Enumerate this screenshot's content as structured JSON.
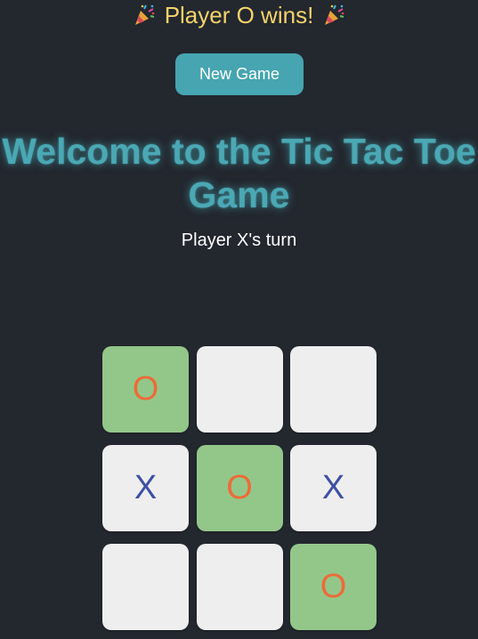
{
  "banner": {
    "message": "Player O wins!",
    "icon_left": "party-popper-icon",
    "icon_right": "party-popper-icon"
  },
  "controls": {
    "new_game_label": "New Game"
  },
  "header": {
    "title": "Welcome to the Tic Tac Toe Game"
  },
  "status": {
    "text": "Player X's turn"
  },
  "board": {
    "cells": [
      {
        "value": "O",
        "winning": true
      },
      {
        "value": "",
        "winning": false
      },
      {
        "value": "",
        "winning": false
      },
      {
        "value": "X",
        "winning": false
      },
      {
        "value": "O",
        "winning": true
      },
      {
        "value": "X",
        "winning": false
      },
      {
        "value": "",
        "winning": false
      },
      {
        "value": "",
        "winning": false
      },
      {
        "value": "O",
        "winning": true
      }
    ]
  },
  "colors": {
    "background": "#23272e",
    "accent": "#46a5b0",
    "banner_text": "#f3d36b",
    "cell": "#eeeeee",
    "winning_cell": "#93c78a",
    "x_mark": "#3e4fa6",
    "o_mark": "#ec6b38"
  }
}
